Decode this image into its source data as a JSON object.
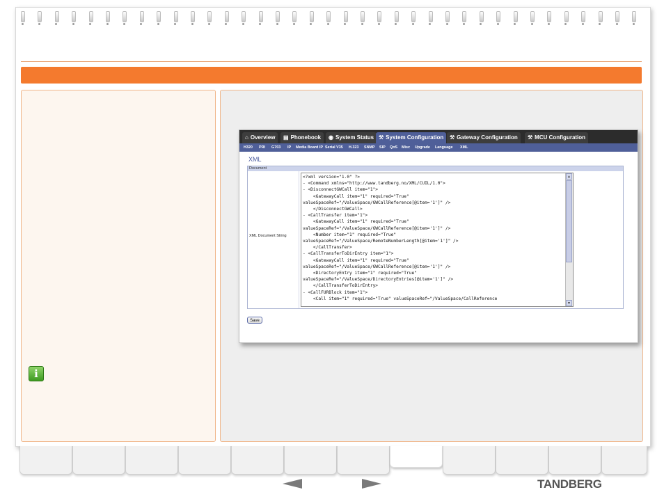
{
  "screenshot": {
    "tabs": [
      {
        "label": "Overview",
        "icon": "home-icon"
      },
      {
        "label": "Phonebook",
        "icon": "book-icon"
      },
      {
        "label": "System Status",
        "icon": "status-icon"
      },
      {
        "label": "System Configuration",
        "icon": "wrench-icon",
        "active": true
      },
      {
        "label": "Gateway Configuration",
        "icon": "wrench-icon"
      },
      {
        "label": "MCU Configuration",
        "icon": "wrench-icon"
      }
    ],
    "subnav": [
      "H320",
      "PRI",
      "G703",
      "IP",
      "Media Board IP",
      "Serial V35",
      "H.323",
      "SNMP",
      "SIP",
      "QoS",
      "Misc",
      "Upgrade",
      "Language",
      "XML"
    ],
    "page_heading": "XML",
    "table_header": "Document",
    "row_label": "XML Document String",
    "xml_lines": [
      "<?xml version=\"1.0\" ?>",
      "- <Command xmlns=\"http://www.tandberg.no/XML/CUIL/1.0\">",
      "- <DisconnectGWCall item=\"1\">",
      "    <GatewayCall item=\"1\" required=\"True\"",
      "valueSpaceRef=\"/ValueSpace/GWCallReference[@item='1']\" />",
      "    </DisconnectGWCall>",
      "- <CallTransfer item=\"1\">",
      "    <GatewayCall item=\"1\" required=\"True\"",
      "valueSpaceRef=\"/ValueSpace/GWCallReference[@item='1']\" />",
      "    <Number item=\"1\" required=\"True\"",
      "valueSpaceRef=\"/ValueSpace/RemoteNumberLength[@item='1']\" />",
      "    </CallTransfer>",
      "- <CallTransferToDirEntry item=\"1\">",
      "    <GatewayCall item=\"1\" required=\"True\"",
      "valueSpaceRef=\"/ValueSpace/GWCallReference[@item='1']\" />",
      "    <DirectoryEntry item=\"1\" required=\"True\"",
      "valueSpaceRef=\"/ValueSpace/DirectoryEntries[@item='1']\" />",
      "    </CallTransferToDirEntry>",
      "- <CallFURBlock item=\"1\">",
      "    <Call item=\"1\" required=\"True\" valueSpaceRef=\"/ValueSpace/CallReference"
    ],
    "save_label": "Save"
  },
  "info_icon_glyph": "i",
  "nav": {
    "prev": "previous-arrow",
    "next": "next-arrow"
  },
  "brand": "TANDBERG",
  "colors": {
    "accent": "#f47a2e",
    "nav_blue": "#4f5f99",
    "tab_dark": "#2c2c2c"
  }
}
